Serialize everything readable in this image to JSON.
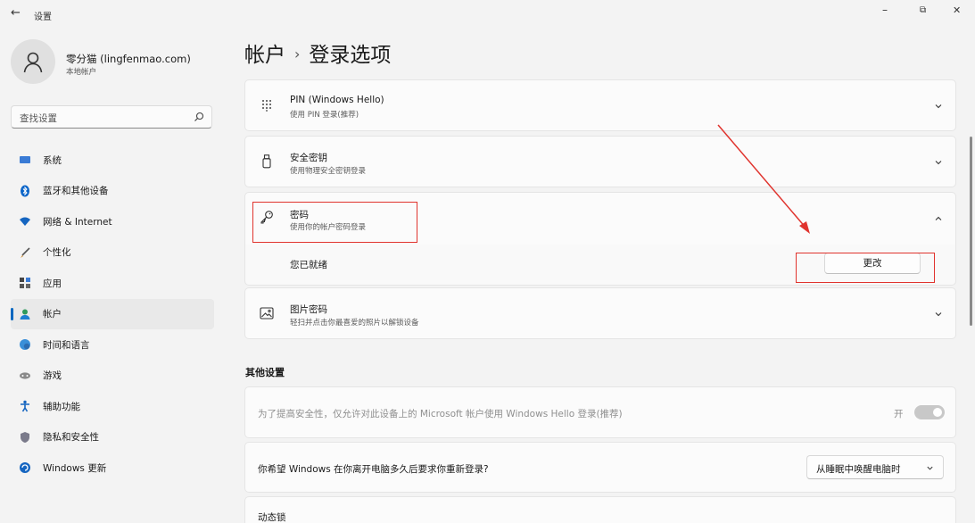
{
  "titlebar": {
    "back": "←",
    "title": "设置",
    "minimize": "–",
    "maximize": "⧉",
    "close": "✕"
  },
  "profile": {
    "name": "零分猫 (lingfenmao.com)",
    "account_type": "本地帐户"
  },
  "search": {
    "placeholder": "查找设置"
  },
  "nav": [
    {
      "label": "系统",
      "icon": "monitor-icon"
    },
    {
      "label": "蓝牙和其他设备",
      "icon": "bluetooth-icon"
    },
    {
      "label": "网络 & Internet",
      "icon": "wifi-icon"
    },
    {
      "label": "个性化",
      "icon": "brush-icon"
    },
    {
      "label": "应用",
      "icon": "apps-icon"
    },
    {
      "label": "帐户",
      "icon": "account-icon",
      "active": true
    },
    {
      "label": "时间和语言",
      "icon": "globe-clock-icon"
    },
    {
      "label": "游戏",
      "icon": "gamepad-icon"
    },
    {
      "label": "辅助功能",
      "icon": "accessibility-icon"
    },
    {
      "label": "隐私和安全性",
      "icon": "shield-icon"
    },
    {
      "label": "Windows 更新",
      "icon": "update-icon"
    }
  ],
  "breadcrumb": {
    "parent": "帐户",
    "separator": "›",
    "current": "登录选项"
  },
  "options": {
    "pin": {
      "title": "PIN (Windows Hello)",
      "subtitle": "使用 PIN 登录(推荐)"
    },
    "security_key": {
      "title": "安全密钥",
      "subtitle": "使用物理安全密钥登录"
    },
    "password": {
      "title": "密码",
      "subtitle": "使用你的帐户密码登录",
      "status": "您已就绪",
      "change_button": "更改"
    },
    "picture_password": {
      "title": "图片密码",
      "subtitle": "轻扫并点击你最喜爱的照片以解锁设备"
    }
  },
  "other": {
    "section_title": "其他设置",
    "hello_only_text": "为了提高安全性，仅允许对此设备上的 Microsoft 帐户使用 Windows Hello 登录(推荐)",
    "hello_only_state": "开",
    "relogin_question": "你希望 Windows 在你离开电脑多久后要求你重新登录?",
    "relogin_value": "从睡眠中唤醒电脑时",
    "dynamic_lock": "动态锁"
  },
  "colors": {
    "accent": "#0067c0",
    "annotation_red": "#e0342e"
  }
}
